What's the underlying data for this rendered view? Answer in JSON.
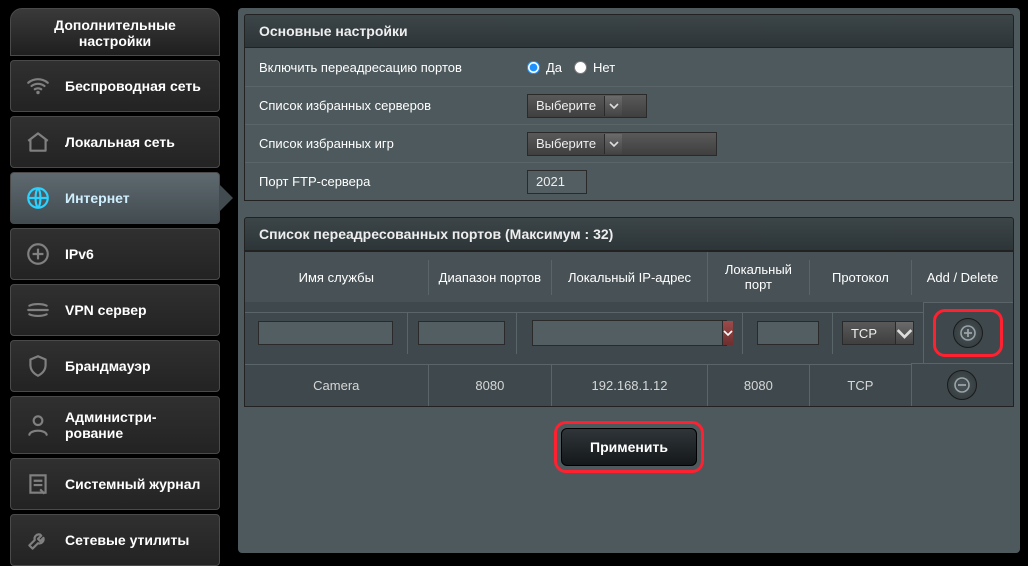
{
  "sidebar": {
    "title": "Дополнительные настройки",
    "items": [
      {
        "label": "Беспроводная сеть",
        "icon": "wifi-icon"
      },
      {
        "label": "Локальная сеть",
        "icon": "house-icon"
      },
      {
        "label": "Интернет",
        "icon": "globe-icon"
      },
      {
        "label": "IPv6",
        "icon": "ipv6-icon"
      },
      {
        "label": "VPN сервер",
        "icon": "vpn-icon"
      },
      {
        "label": "Брандмауэр",
        "icon": "shield-icon"
      },
      {
        "label": "Администри-рование",
        "icon": "user-icon"
      },
      {
        "label": "Системный журнал",
        "icon": "log-icon"
      },
      {
        "label": "Сетевые утилиты",
        "icon": "wrench-icon"
      }
    ],
    "selected_index": 2
  },
  "basic": {
    "section_title": "Основные настройки",
    "rows": {
      "enable_forwarding": {
        "label": "Включить переадресацию портов",
        "yes": "Да",
        "no": "Нет",
        "value": "yes"
      },
      "favorite_servers": {
        "label": "Список избранных серверов",
        "selected": "Выберите"
      },
      "favorite_games": {
        "label": "Список избранных игр",
        "selected": "Выберите"
      },
      "ftp_port": {
        "label": "Порт FTP-сервера",
        "value": "2021"
      }
    }
  },
  "forward": {
    "section_title": "Список переадресованных портов (Максимум : 32)",
    "headers": {
      "service": "Имя службы",
      "range": "Диапазон портов",
      "ip": "Локальный IP-адрес",
      "port": "Локальный порт",
      "proto": "Протокол",
      "action": "Add / Delete"
    },
    "input_row": {
      "service": "",
      "range": "",
      "ip": "",
      "port": "",
      "proto": "TCP"
    },
    "rows": [
      {
        "service": "Camera",
        "range": "8080",
        "ip": "192.168.1.12",
        "port": "8080",
        "proto": "TCP"
      }
    ]
  },
  "apply_label": "Применить"
}
